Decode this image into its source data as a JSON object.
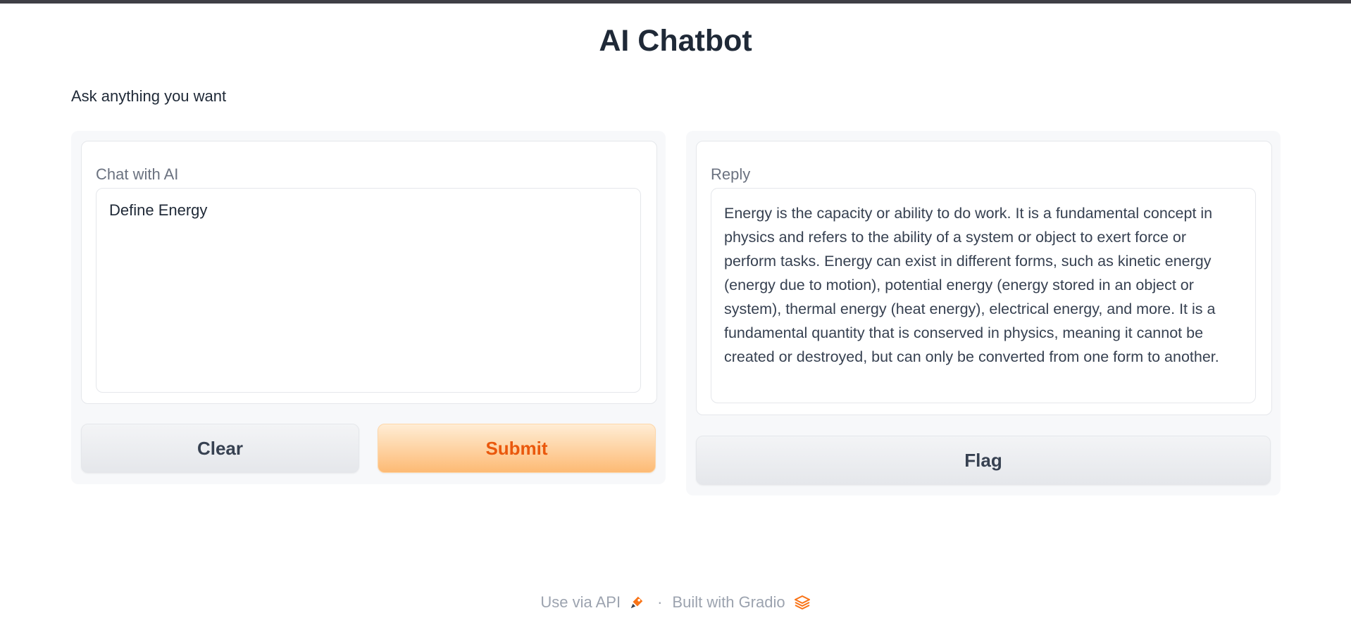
{
  "app": {
    "title": "AI Chatbot",
    "description": "Ask anything you want"
  },
  "input": {
    "label": "Chat with AI",
    "value": "Define Energy"
  },
  "output": {
    "label": "Reply",
    "value": "Energy is the capacity or ability to do work. It is a fundamental concept in physics and refers to the ability of a system or object to exert force or perform tasks. Energy can exist in different forms, such as kinetic energy (energy due to motion), potential energy (energy stored in an object or system), thermal energy (heat energy), electrical energy, and more. It is a fundamental quantity that is conserved in physics, meaning it cannot be created or destroyed, but can only be converted from one form to another."
  },
  "buttons": {
    "clear": "Clear",
    "submit": "Submit",
    "flag": "Flag"
  },
  "footer": {
    "api_link": "Use via API",
    "separator": "·",
    "built_with": "Built with Gradio",
    "icons": [
      "rocket-icon",
      "gradio-logo-icon"
    ]
  },
  "colors": {
    "accent": "#ea580c",
    "primary_button_gradient": [
      "#ffedd5",
      "#fdba74"
    ],
    "topbar": "#3f3f46"
  }
}
